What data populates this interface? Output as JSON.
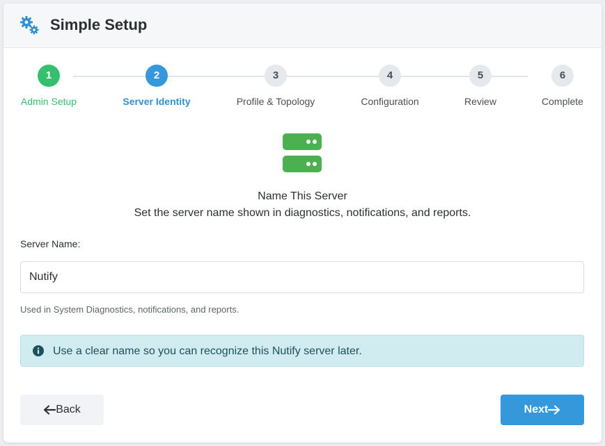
{
  "header": {
    "title": "Simple Setup",
    "icon": "gears-icon"
  },
  "stepper": {
    "current": 2,
    "steps": [
      {
        "number": "1",
        "label": "Admin Setup",
        "state": "done"
      },
      {
        "number": "2",
        "label": "Server Identity",
        "state": "active"
      },
      {
        "number": "3",
        "label": "Profile & Topology",
        "state": "pending"
      },
      {
        "number": "4",
        "label": "Configuration",
        "state": "pending"
      },
      {
        "number": "5",
        "label": "Review",
        "state": "pending"
      },
      {
        "number": "6",
        "label": "Complete",
        "state": "pending"
      }
    ]
  },
  "main": {
    "icon": "server-icon",
    "heading": "Name This Server",
    "subheading": "Set the server name shown in diagnostics, notifications, and reports.",
    "field_label": "Server Name:",
    "server_name_value": "Nutify",
    "help_text": "Used in System Diagnostics, notifications, and reports.",
    "alert_text": "Use a clear name so you can recognize this Nutify server later."
  },
  "footer": {
    "back_label": "Back",
    "next_label": "Next"
  },
  "colors": {
    "done": "#35c06e",
    "active": "#3498db",
    "server_icon": "#4caf50",
    "alert_bg": "#d1ecf1"
  }
}
